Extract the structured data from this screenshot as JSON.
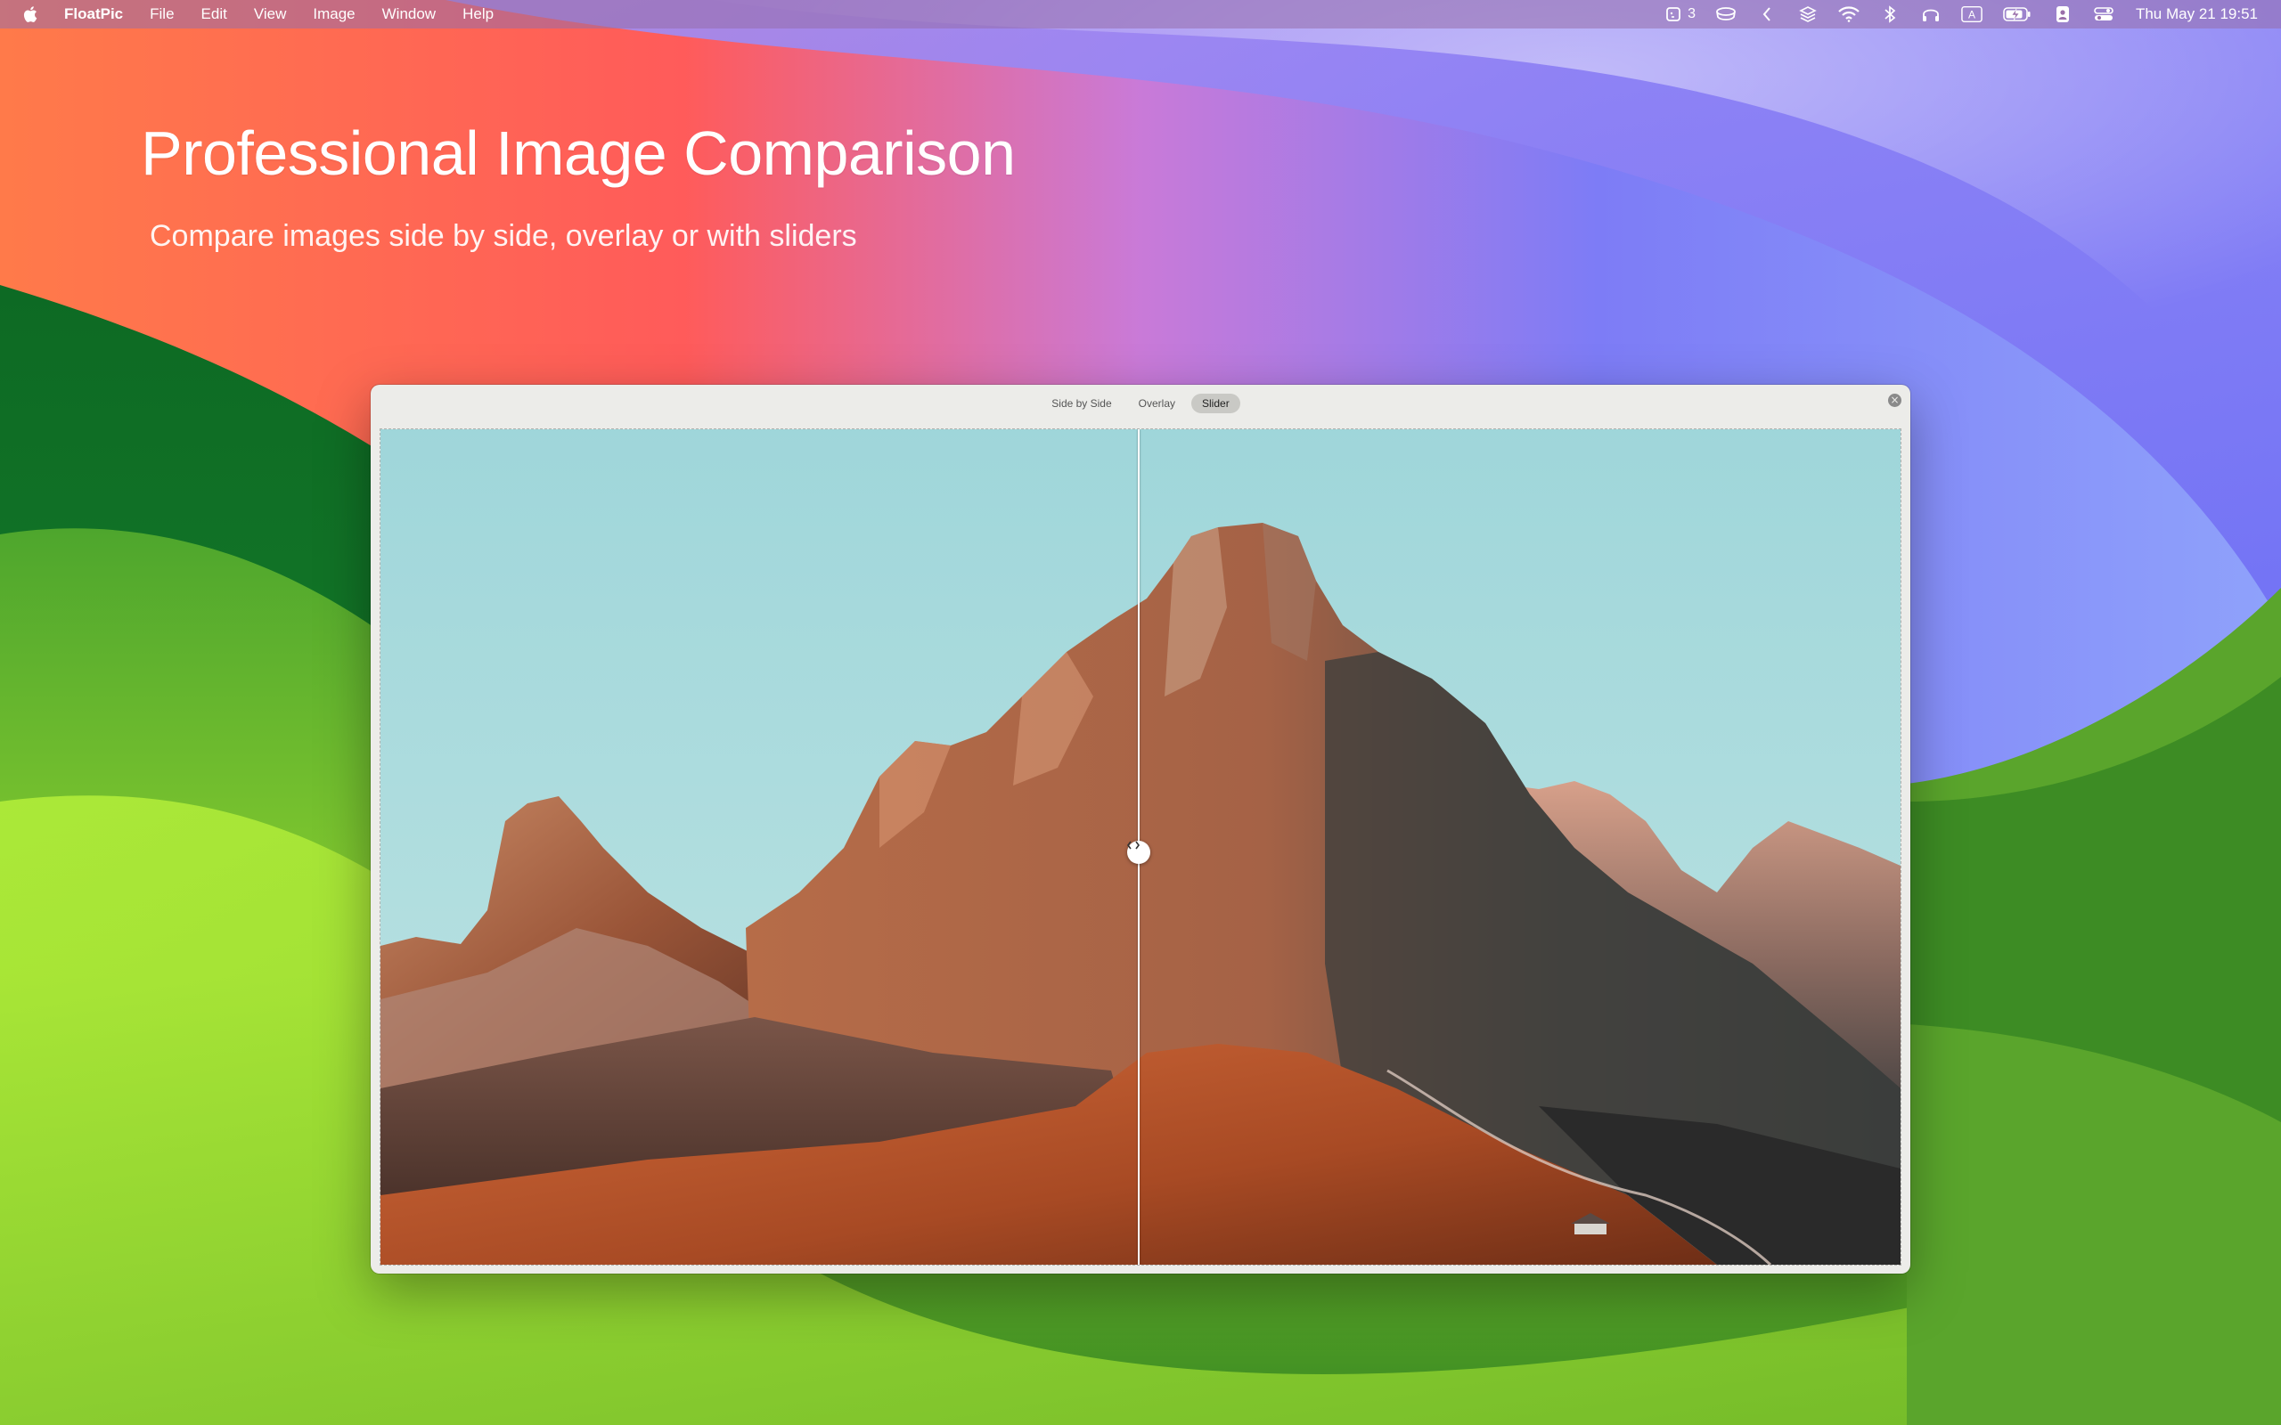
{
  "menubar": {
    "app_name": "FloatPic",
    "menus": [
      "File",
      "Edit",
      "View",
      "Image",
      "Window",
      "Help"
    ],
    "status_icons": [
      "stage-manager-icon",
      "cup-icon",
      "chevron-left-icon",
      "layers-icon",
      "wifi-icon",
      "bluetooth-icon",
      "headphones-icon",
      "input-source-icon",
      "battery-charging-icon",
      "user-icon",
      "control-center-icon"
    ],
    "stage_count": "3",
    "input_source": "A",
    "clock": "Thu May 21  19:51"
  },
  "hero": {
    "title": "Professional Image Comparison",
    "subtitle": "Compare images side by side, overlay or with sliders"
  },
  "window": {
    "modes": [
      "Side by Side",
      "Overlay",
      "Slider"
    ],
    "active_mode": "Slider",
    "slider_position": 0.5
  },
  "colors": {
    "menubar_bg": "#9a6eaa",
    "window_bg": "#ecece9",
    "sky": "#a3d8dc",
    "rock_warm": "#a45a3a",
    "rock_cool": "#4a4a46",
    "meadow": "#b5532a"
  }
}
